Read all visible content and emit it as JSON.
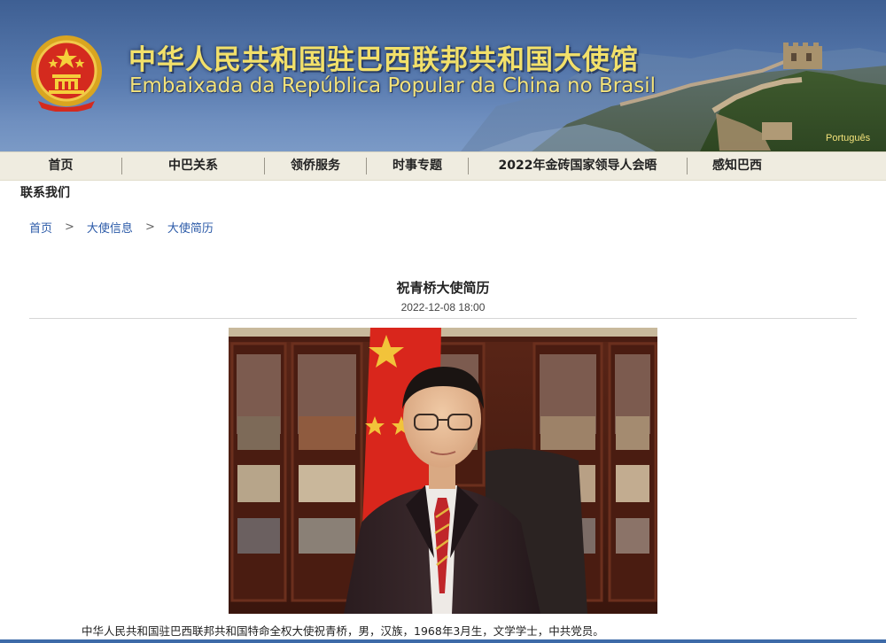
{
  "header": {
    "title_cn": "中华人民共和国驻巴西联邦共和国大使馆",
    "title_pt": "Embaixada da República Popular da China no Brasil",
    "language_link": "Português",
    "emblem_icon": "national-emblem-icon",
    "colors": {
      "title": "#f2e06a",
      "banner": "#4a6aa0"
    }
  },
  "nav": {
    "items": [
      {
        "label": "首页"
      },
      {
        "label": "中巴关系"
      },
      {
        "label": "领侨服务"
      },
      {
        "label": "时事专题"
      },
      {
        "label": "2022年金砖国家领导人会晤"
      },
      {
        "label": "感知巴西"
      }
    ],
    "row2": "联系我们"
  },
  "breadcrumb": {
    "items": [
      "首页",
      "大使信息",
      "大使简历"
    ],
    "separator": ">"
  },
  "article": {
    "title": "祝青桥大使简历",
    "date": "2022-12-08 18:00",
    "body": "中华人民共和国驻巴西联邦共和国特命全权大使祝青桥，男，汉族，1968年3月生，文学学士，中共党员。"
  }
}
